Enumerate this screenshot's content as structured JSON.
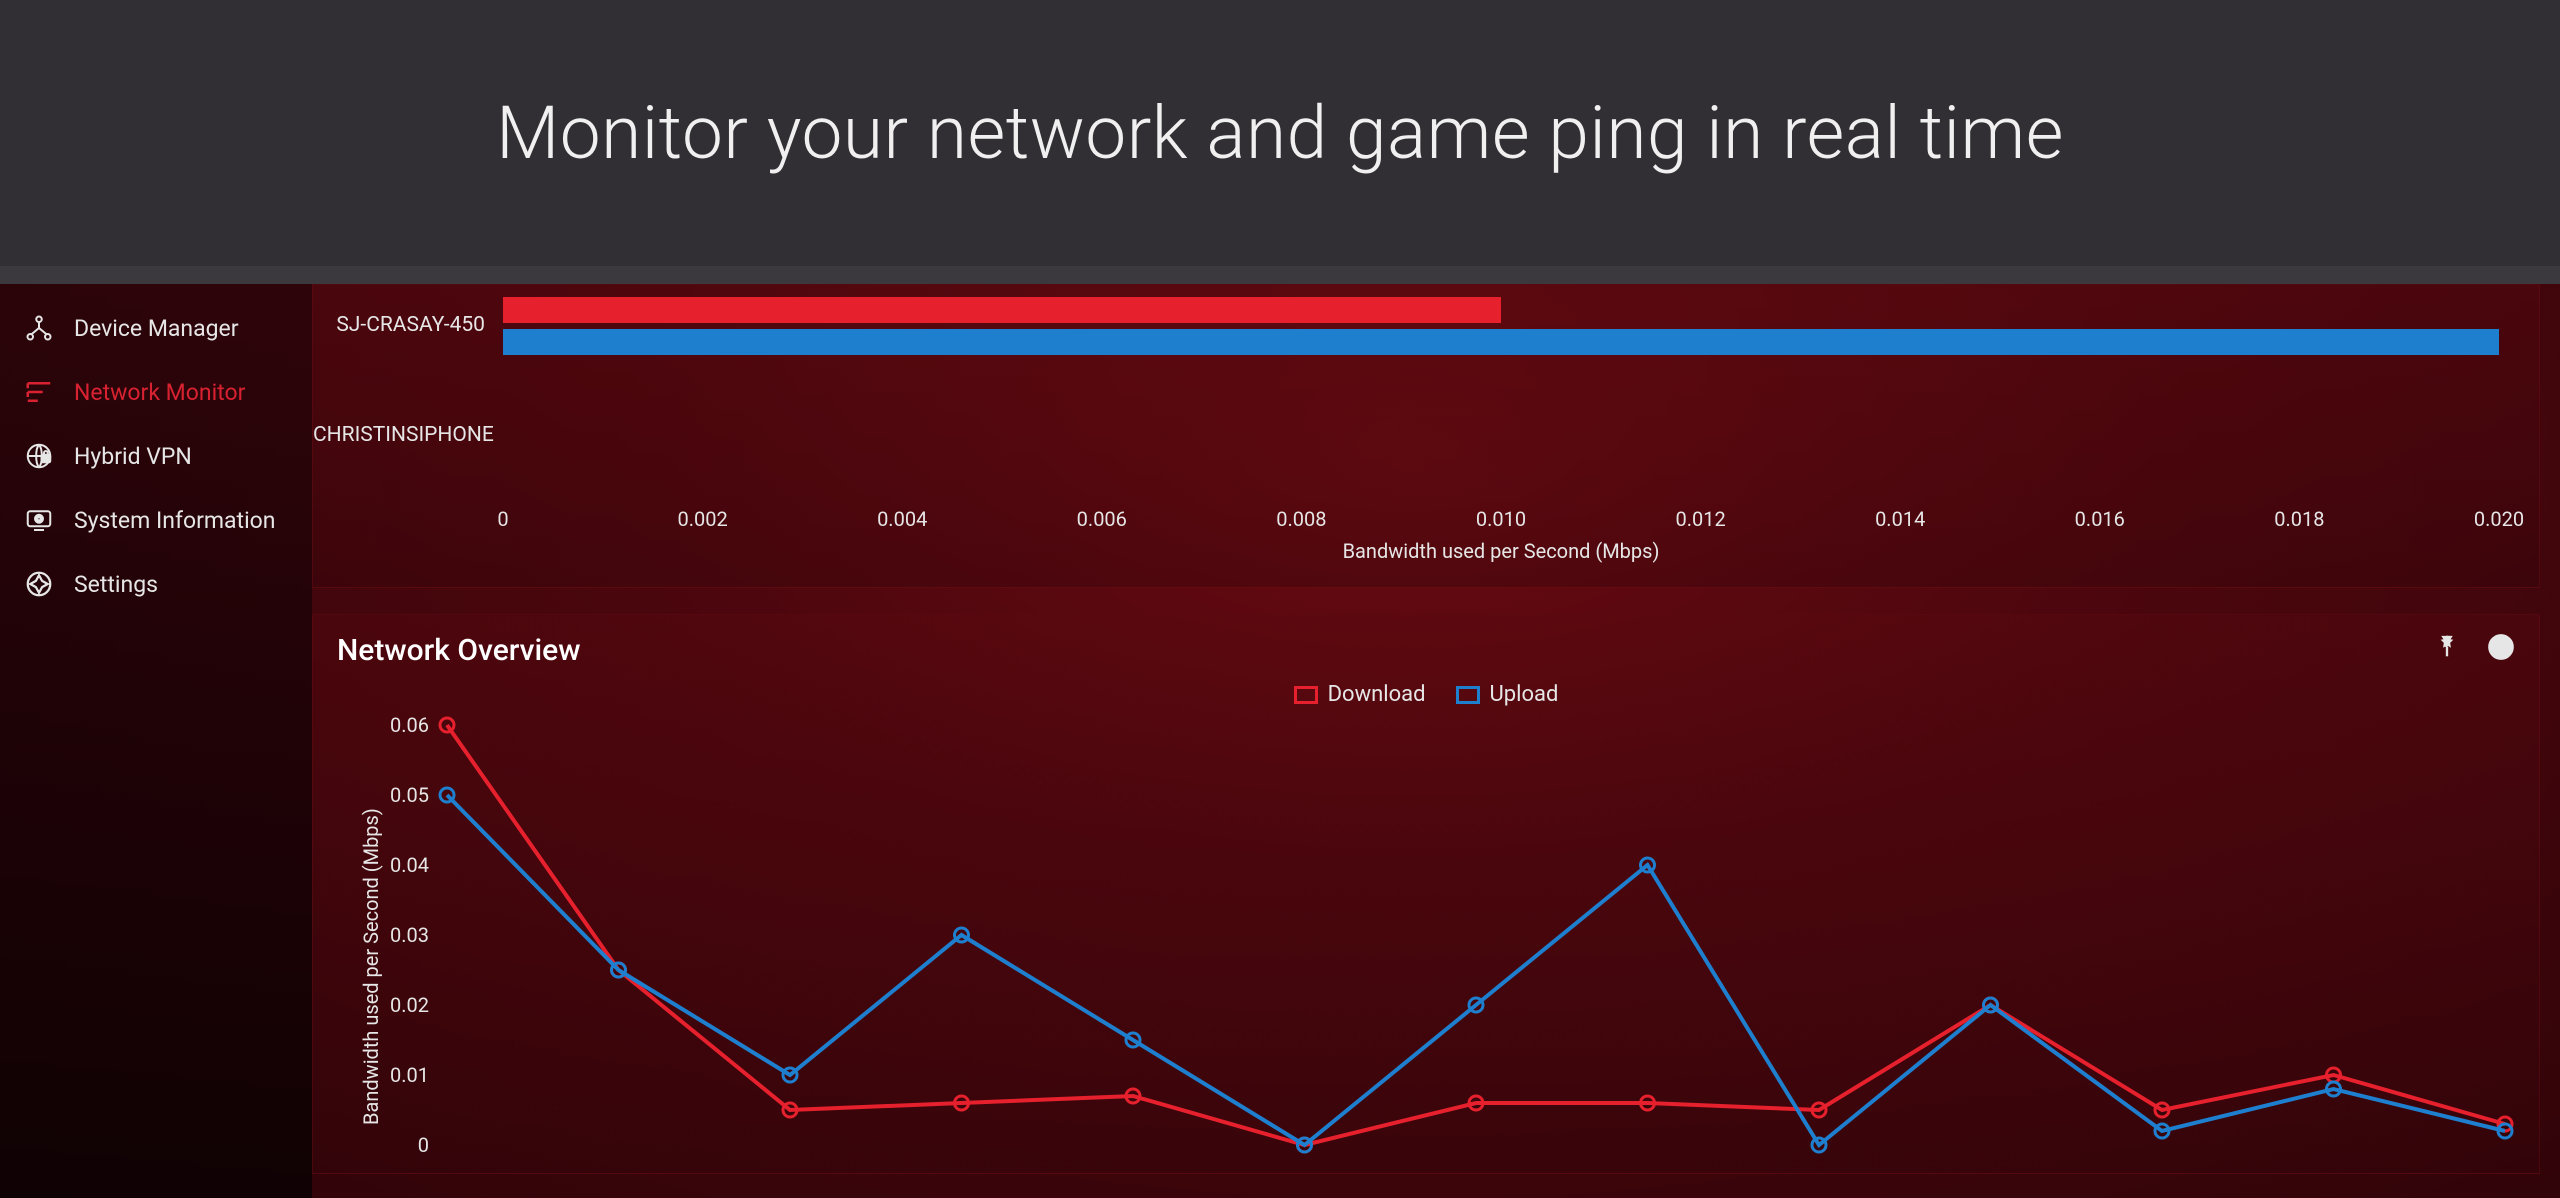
{
  "header": {
    "title": "Monitor your network and game ping in real time"
  },
  "sidebar": {
    "items": [
      {
        "label": "Device Manager",
        "icon": "device-manager-icon",
        "active": false
      },
      {
        "label": "Network Monitor",
        "icon": "network-monitor-icon",
        "active": true
      },
      {
        "label": "Hybrid VPN",
        "icon": "hybrid-vpn-icon",
        "active": false
      },
      {
        "label": "System Information",
        "icon": "system-information-icon",
        "active": false
      },
      {
        "label": "Settings",
        "icon": "settings-icon",
        "active": false
      }
    ]
  },
  "panels": {
    "bandwidth": {
      "xaxis_title": "Bandwidth used per Second (Mbps)"
    },
    "overview": {
      "title": "Network Overview",
      "legend": {
        "download": "Download",
        "upload": "Upload"
      },
      "yaxis_title": "Bandwidth used per Second (Mbps)"
    }
  },
  "colors": {
    "download": "#e6202c",
    "upload": "#1f7fcf",
    "accent": "#d92231"
  },
  "chart_data": [
    {
      "type": "bar",
      "title": "",
      "xlabel": "Bandwidth used per Second (Mbps)",
      "ylabel": "",
      "xlim": [
        0,
        0.02
      ],
      "xticks": [
        0,
        0.002,
        0.004,
        0.006,
        0.008,
        0.01,
        0.012,
        0.014,
        0.016,
        0.018,
        0.02
      ],
      "categories": [
        "SJ-CRASAY-450",
        "CHRISTINSIPHONE"
      ],
      "series": [
        {
          "name": "Download",
          "color": "#e6202c",
          "values": [
            0.01,
            0.0
          ]
        },
        {
          "name": "Upload",
          "color": "#1f7fcf",
          "values": [
            0.02,
            0.0
          ]
        }
      ]
    },
    {
      "type": "line",
      "title": "Network Overview",
      "xlabel": "",
      "ylabel": "Bandwidth used per Second (Mbps)",
      "ylim": [
        0,
        0.06
      ],
      "yticks": [
        0,
        0.01,
        0.02,
        0.03,
        0.04,
        0.05,
        0.06
      ],
      "x": [
        0,
        1,
        2,
        3,
        4,
        5,
        6,
        7,
        8,
        9,
        10,
        11,
        12
      ],
      "legend_position": "top-center",
      "series": [
        {
          "name": "Download",
          "color": "#e6202c",
          "values": [
            0.06,
            0.025,
            0.005,
            0.006,
            0.007,
            0.0,
            0.006,
            0.006,
            0.005,
            0.02,
            0.005,
            0.01,
            0.003
          ]
        },
        {
          "name": "Upload",
          "color": "#1f7fcf",
          "values": [
            0.05,
            0.025,
            0.01,
            0.03,
            0.015,
            0.0,
            0.02,
            0.04,
            0.0,
            0.02,
            0.002,
            0.008,
            0.002
          ]
        }
      ]
    }
  ]
}
